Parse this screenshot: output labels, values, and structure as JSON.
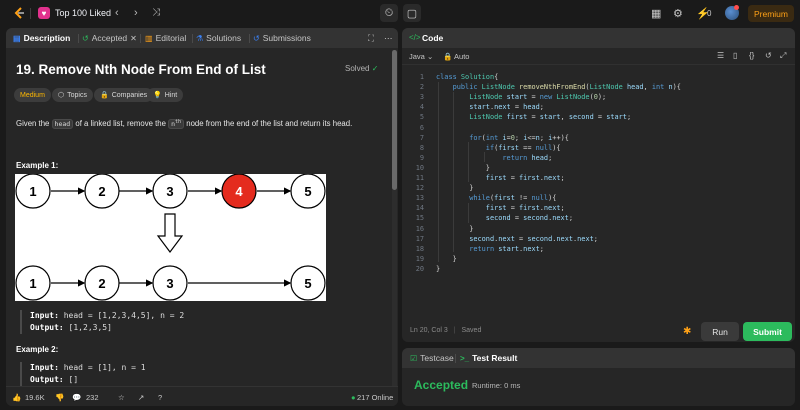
{
  "topbar": {
    "list_title": "Top 100 Liked",
    "streak": "0",
    "premium_label": "Premium",
    "list_badge_icon": "heart-icon"
  },
  "left": {
    "tabs": [
      {
        "label": "Description"
      },
      {
        "label": "Accepted"
      },
      {
        "label": "Editorial"
      },
      {
        "label": "Solutions"
      },
      {
        "label": "Submissions"
      }
    ],
    "title": "19. Remove Nth Node From End of List",
    "solved_label": "Solved",
    "tags": [
      "Medium",
      "Topics",
      "Companies",
      "Hint"
    ],
    "desc_pre": "Given the",
    "desc_code1": "head",
    "desc_mid": "of a linked list, remove the",
    "desc_code2": "n",
    "desc_sup": "th",
    "desc_post": "node from the end of the list and return its head.",
    "example1_title": "Example 1:",
    "example1_input_label": "Input:",
    "example1_input": "head = [1,2,3,4,5], n = 2",
    "example1_output_label": "Output:",
    "example1_output": "[1,2,3,5]",
    "example2_title": "Example 2:",
    "example2_input_label": "Input:",
    "example2_input": "head = [1], n = 1",
    "example2_output_label": "Output:",
    "example2_output": "[]",
    "diagram_top_nodes": [
      "1",
      "2",
      "3",
      "4",
      "5"
    ],
    "diagram_bottom_nodes": [
      "1",
      "2",
      "3",
      "5"
    ],
    "removed_node_color": "#e42b1e",
    "likes": "19.6K",
    "comments": "232",
    "online": "217 Online"
  },
  "code": {
    "header_label": "Code",
    "language": "Java",
    "mode": "Auto",
    "lines": [
      "class Solution{",
      "    public ListNode removeNthFromEnd(ListNode head, int n){",
      "        ListNode start = new ListNode(0);",
      "        start.next = head;",
      "        ListNode first = start, second = start;",
      "",
      "        for(int i=0; i<=n; i++){",
      "            if(first == null){",
      "                return head;",
      "            }",
      "            first = first.next;",
      "        }",
      "        while(first != null){",
      "            first = first.next;",
      "            second = second.next;",
      "        }",
      "        second.next = second.next.next;",
      "        return start.next;",
      "    }",
      "}"
    ],
    "status": "Ln 20, Col 3",
    "saved": "Saved",
    "run_label": "Run",
    "submit_label": "Submit"
  },
  "result": {
    "tab_testcase": "Testcase",
    "tab_result": "Test Result",
    "status": "Accepted",
    "runtime": "Runtime: 0 ms",
    "accent": "#2cbb5d"
  }
}
